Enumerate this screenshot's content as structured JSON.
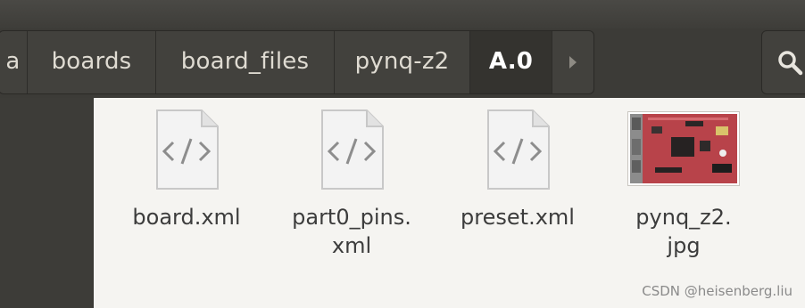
{
  "path_bar": {
    "crumbs": [
      {
        "label": "a"
      },
      {
        "label": "boards"
      },
      {
        "label": "board_files"
      },
      {
        "label": "pynq-z2"
      },
      {
        "label": "A.0"
      }
    ]
  },
  "toolbar": {
    "search_icon": "search-icon",
    "forward_icon": "chevron-right-icon"
  },
  "files": [
    {
      "name": "board.xml",
      "icon": "xml-file-icon"
    },
    {
      "name": "part0_pins.\nxml",
      "icon": "xml-file-icon"
    },
    {
      "name": "preset.xml",
      "icon": "xml-file-icon"
    },
    {
      "name": "pynq_z2.\njpg",
      "icon": "image-thumbnail"
    }
  ],
  "watermark": "CSDN @heisenberg.liu",
  "colors": {
    "bg_dark": "#3c3b37",
    "content_bg": "#f5f4f1",
    "text": "#3c3c3c"
  }
}
